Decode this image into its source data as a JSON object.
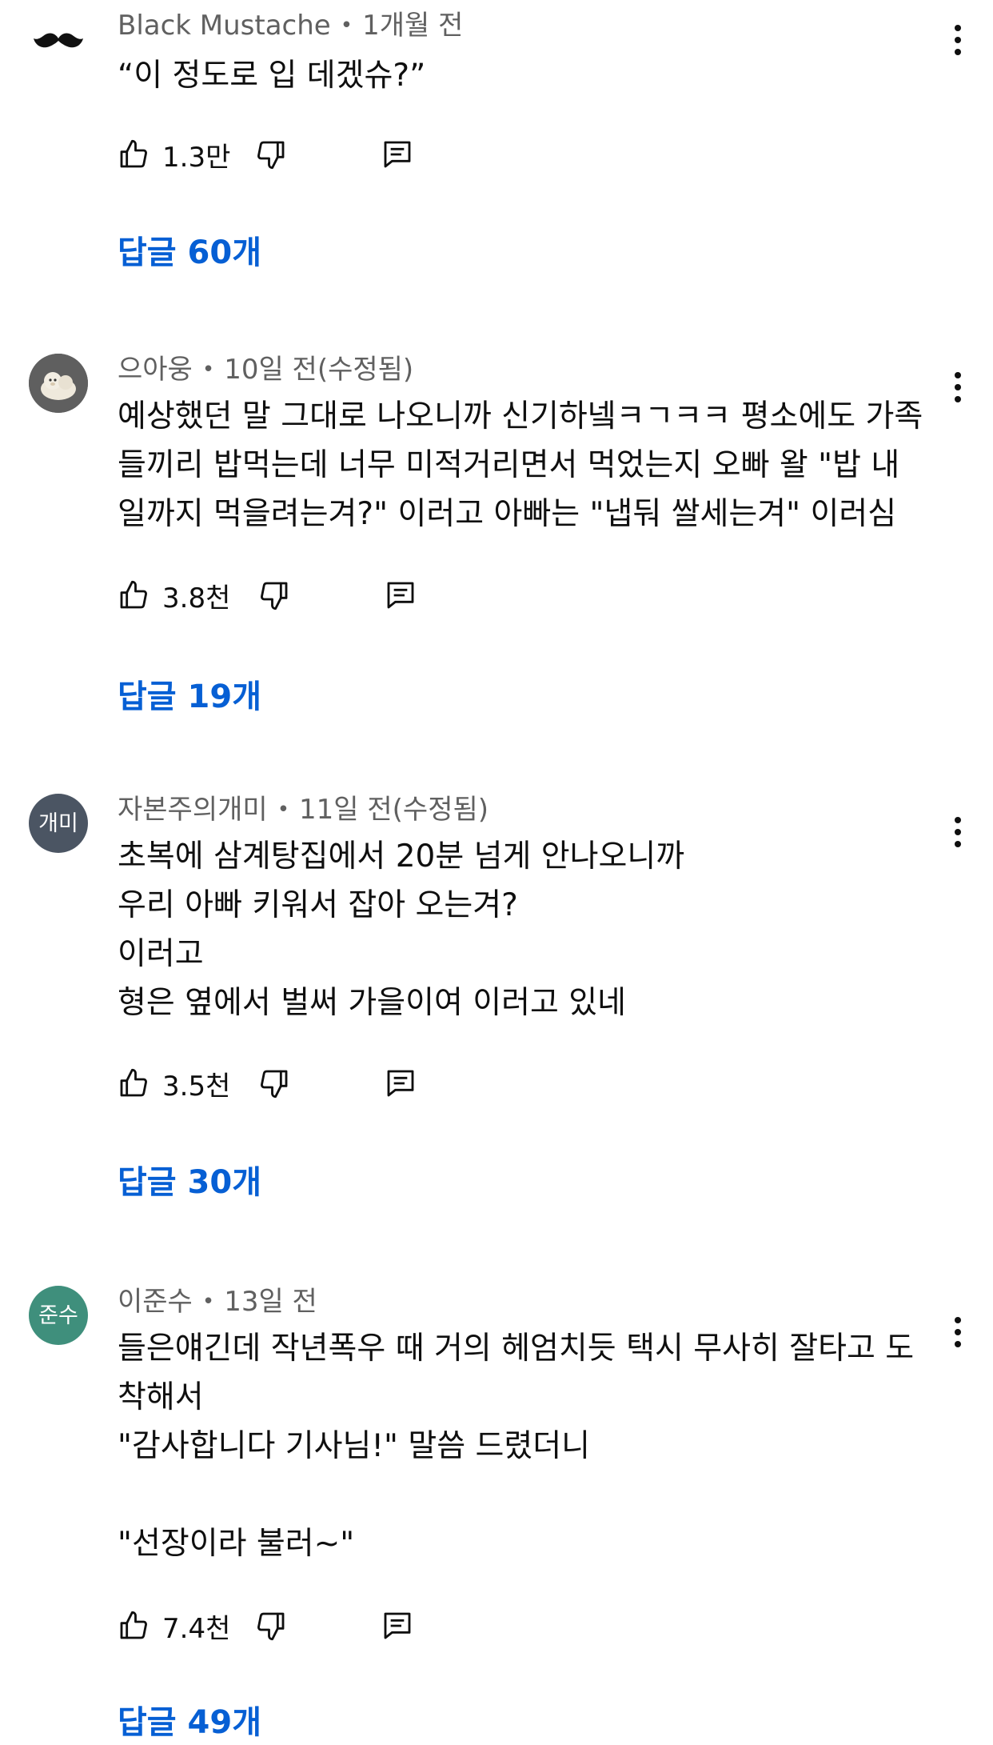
{
  "comments": [
    {
      "author": "Black Mustache",
      "time": "1개월 전",
      "avatar_type": "mustache",
      "avatar_label": "",
      "avatar_color": "#ffffff",
      "lines": [
        "“이 정도로 입 데겠슈?”"
      ],
      "likes": "1.3만",
      "replies": "답글 60개"
    },
    {
      "author": "으아웅",
      "time": "10일 전(수정됨)",
      "avatar_type": "photo",
      "avatar_label": "",
      "avatar_color": "#6b6b6b",
      "lines": [
        "예상했던 말 그대로 나오니까 신기하넼ㅋㄱㅋㅋ 평소에도 가족",
        "들끼리 밥먹는데 너무 미적거리면서 먹었는지 오빠 왈 \"밥 내",
        "일까지 먹을려는겨?\" 이러고 아빠는 \"냅둬 쌀세는겨\" 이러심"
      ],
      "likes": "3.8천",
      "replies": "답글 19개"
    },
    {
      "author": "자본주의개미",
      "time": "11일 전(수정됨)",
      "avatar_type": "text",
      "avatar_label": "개미",
      "avatar_color": "#4b5563",
      "lines": [
        "초복에 삼계탕집에서 20분 넘게 안나오니까",
        "우리 아빠 키워서 잡아 오는겨?",
        "이러고",
        "형은 옆에서 벌써 가을이여 이러고 있네"
      ],
      "likes": "3.5천",
      "replies": "답글 30개"
    },
    {
      "author": "이준수",
      "time": "13일 전",
      "avatar_type": "text",
      "avatar_label": "준수",
      "avatar_color": "#3f8f7c",
      "lines": [
        "들은얘긴데 작년폭우 때 거의 헤엄치듯 택시 무사히 잘타고 도",
        "착해서",
        "\"감사합니다 기사님!\" 말씀 드렸더니",
        "",
        "\"선장이라 불러~\""
      ],
      "likes": "7.4천",
      "replies": "답글 49개"
    }
  ]
}
